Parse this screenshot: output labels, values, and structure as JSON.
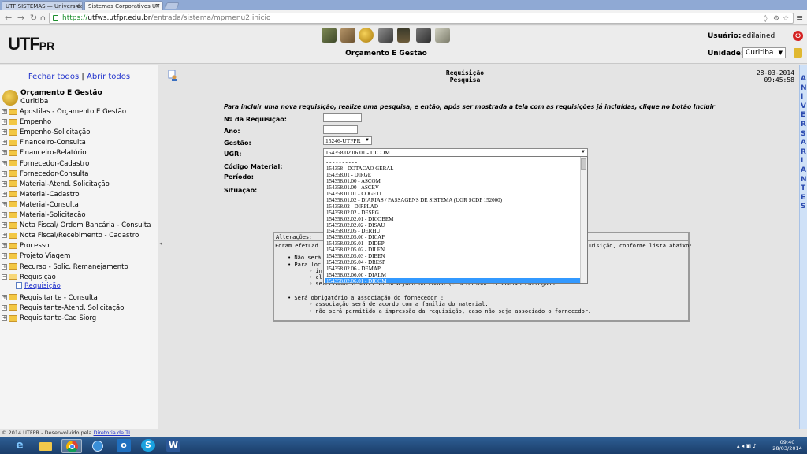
{
  "browser": {
    "tabs": [
      {
        "label": "UTF SISTEMAS — Universidade",
        "active": false
      },
      {
        "label": "Sistemas Corporativos UT",
        "active": true
      }
    ],
    "url_scheme": "https://",
    "url_host": "utfws.utfpr.edu.br",
    "url_path": "/entrada/sistema/mpmenu2.inicio"
  },
  "header": {
    "logo_main": "UTF",
    "logo_sub": "PR",
    "module_title": "Orçamento E Gestão",
    "user_label": "Usuário:",
    "user_value": "edilained",
    "unit_label": "Unidade:",
    "unit_value": "Curitiba",
    "module_icons": [
      "star-icon",
      "box-icon",
      "coin-icon",
      "safe-icon",
      "person-icon",
      "monitor-icon",
      "clipboard-icon"
    ]
  },
  "sidebar": {
    "close_all": "Fechar todos",
    "separator": "|",
    "open_all": "Abrir todos",
    "root_title": "Orçamento E Gestão",
    "root_sub": "Curitiba",
    "items": [
      {
        "label": "Apostilas - Orçamento E Gestão",
        "open": false
      },
      {
        "label": "Empenho",
        "open": false
      },
      {
        "label": "Empenho-Solicitação",
        "open": false
      },
      {
        "label": "Financeiro-Consulta",
        "open": false
      },
      {
        "label": "Financeiro-Relatório",
        "open": false
      },
      {
        "label": "Fornecedor-Cadastro",
        "open": false
      },
      {
        "label": "Fornecedor-Consulta",
        "open": false
      },
      {
        "label": "Material-Atend. Solicitação",
        "open": false
      },
      {
        "label": "Material-Cadastro",
        "open": false
      },
      {
        "label": "Material-Consulta",
        "open": false
      },
      {
        "label": "Material-Solicitação",
        "open": false
      },
      {
        "label": "Nota Fiscal/ Ordem Bancária - Consulta",
        "open": false
      },
      {
        "label": "Nota Fiscal/Recebimento - Cadastro",
        "open": false
      },
      {
        "label": "Processo",
        "open": false
      },
      {
        "label": "Projeto Viagem",
        "open": false
      },
      {
        "label": "Recurso - Solic. Remanejamento",
        "open": false
      },
      {
        "label": "Requisição",
        "open": true
      },
      {
        "label": "Requisitante - Consulta",
        "open": false
      },
      {
        "label": "Requisitante-Atend. Solicitação",
        "open": false
      },
      {
        "label": "Requisitante-Cad Siorg",
        "open": false
      }
    ],
    "sub_item": "Requisição",
    "footer_text": "© 2014 UTFPR - Desenvolvido pela",
    "footer_link": "Diretoria de TI"
  },
  "main": {
    "title_line1": "Requisição",
    "title_line2": "Pesquisa",
    "date": "28-03-2014",
    "time": "09:45:58",
    "instructions": "Para incluir uma nova requisição, realize uma pesquisa, e então, após ser mostrada a tela com as requisições já incluídas, clique no botão Incluir",
    "fields": {
      "numero_label": "Nº da Requisição:",
      "ano_label": "Ano:",
      "gestao_label": "Gestão:",
      "gestao_value": "15246-UTFPR",
      "ugr_label": "UGR:",
      "ugr_value": "154358.02.06.01 - DICOM",
      "codigo_label": "Código Material:",
      "periodo_label": "Período:",
      "situacao_label": "Situação:"
    },
    "dropdown_options": [
      "- - - - - - - - - -",
      "154358 - DOTACAO GERAL",
      "154358.01 - DIRGE",
      "154358.01.00 - ASCOM",
      "154358.01.00 - ASCEV",
      "154358.01.01 - COGETI",
      "154358.01.02 - DIARIAS / PASSAGENS DE SISTEMA (UGR SCDP 152000)",
      "154358.02 - DIRPLAD",
      "154358.02.02 - DESEG",
      "154358.02.02.01 - DICOBEM",
      "154358.02.02.02 - DISAU",
      "154358.02.05 - DERHU",
      "154358.02.05.00 - DICAP",
      "154358.02.05.01 - DIDEP",
      "154358.02.05.02 - DILEN",
      "154358.02.05.03 - DIBEN",
      "154358.02.05.04 - DRESP",
      "154358.02.06 - DEMAP",
      "154358.02.06.00 - DIALM",
      "154358.02.06.01 - DICOM"
    ],
    "selected_index": 19,
    "alteracoes_title": "Alterações:",
    "alt_intro_left": "Foram efetuad",
    "alt_intro_right": "uisição, conforme lista abaixo:",
    "alt_b1": "• Não será",
    "alt_b2": "• Para loc",
    "alt_s1": "◦ in",
    "alt_s2": "◦ cl",
    "alt_s3": "◦ selecionar o material desejado no combo (- Selecione -) abaixo carregado.",
    "alt_b3": "• Será obrigatório a associação do fornecedor :",
    "alt_s4": "◦ associação será de acordo com a família do material.",
    "alt_s5": "◦ não será permitido a impressão da requisição, caso não seja associado o fornecedor."
  },
  "aniversariantes": "ANIVERSARIANTES",
  "taskbar": {
    "apps": [
      "ie-icon",
      "explorer-icon",
      "chrome-icon",
      "app-icon",
      "outlook-icon",
      "skype-icon",
      "word-icon"
    ],
    "time": "09:40",
    "date": "28/03/2014"
  }
}
